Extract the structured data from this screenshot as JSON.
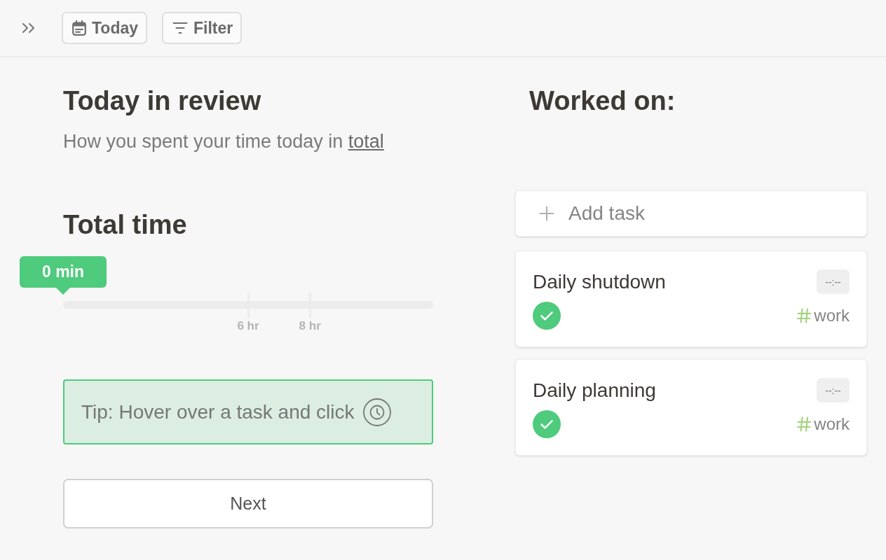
{
  "toolbar": {
    "buttons": [
      {
        "kind": "calendar",
        "label": "Today"
      },
      {
        "kind": "filter",
        "label": "Filter"
      }
    ]
  },
  "review": {
    "title": "Today in review",
    "subtitle": "How you spent your time today in",
    "link": "total"
  },
  "total_time": {
    "title": "Total time",
    "reading": "0 min",
    "level": 0,
    "markers": [
      {
        "label": "6 hr",
        "level": 0.5
      },
      {
        "label": "8 hr",
        "level": 0.667
      }
    ]
  },
  "tip": {
    "text": "Tip: Hover over a task and click"
  },
  "next_button": {
    "label": "Next"
  },
  "worked_on": {
    "title": "Worked on:",
    "add_task": {
      "label": "Add task"
    },
    "tasks": [
      {
        "title": "Daily shutdown",
        "estimate": "--:--",
        "done": true,
        "tag": "work"
      },
      {
        "title": "Daily planning",
        "estimate": "--:--",
        "done": true,
        "tag": "work"
      }
    ]
  }
}
